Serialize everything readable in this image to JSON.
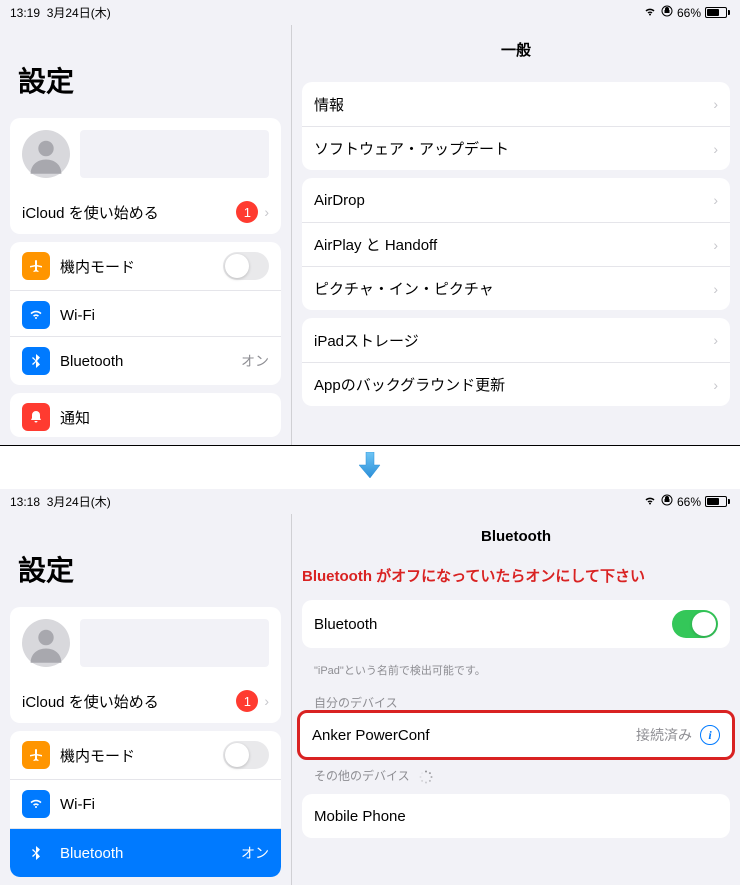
{
  "status": {
    "time": "13:19",
    "date": "3月24日(木)",
    "battery": "66%"
  },
  "status2": {
    "time": "13:18",
    "date": "3月24日(木)",
    "battery": "66%"
  },
  "settings_title": "設定",
  "icloud": {
    "label": "iCloud を使い始める",
    "badge": "1"
  },
  "sidebar": {
    "airplane": "機内モード",
    "wifi": "Wi-Fi",
    "bluetooth": "Bluetooth",
    "bluetooth_value": "オン",
    "notifications": "通知"
  },
  "general": {
    "title": "一般",
    "about": "情報",
    "software_update": "ソフトウェア・アップデート",
    "airdrop": "AirDrop",
    "airplay": "AirPlay と Handoff",
    "pip": "ピクチャ・イン・ピクチャ",
    "storage": "iPadストレージ",
    "bg_refresh": "Appのバックグラウンド更新"
  },
  "bt": {
    "title": "Bluetooth",
    "note": "Bluetooth がオフになっていたらオンにして下さい",
    "label": "Bluetooth",
    "hint": "\"iPad\"という名前で検出可能です。",
    "my_devices": "自分のデバイス",
    "device1": "Anker PowerConf",
    "device1_status": "接続済み",
    "other_devices": "その他のデバイス",
    "device2": "Mobile Phone"
  }
}
